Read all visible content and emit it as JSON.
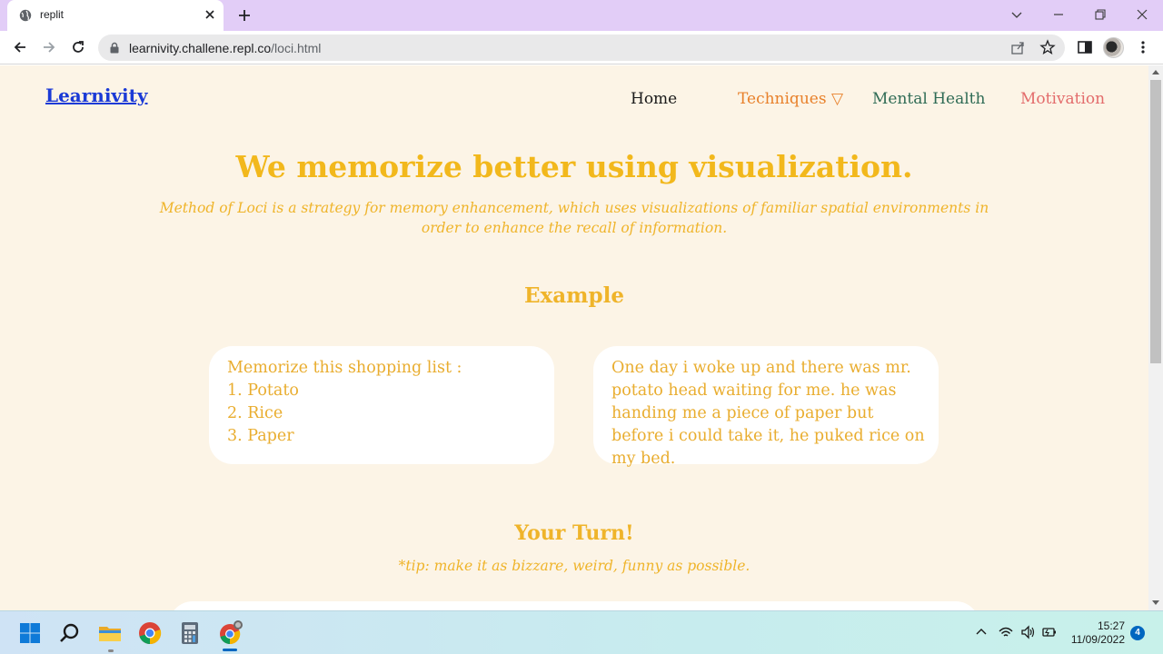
{
  "browser": {
    "tab_title": "replit",
    "url_host": "learnivity.challene.repl.co",
    "url_path": "/loci.html"
  },
  "site": {
    "brand": "Learnivity",
    "nav": {
      "home": "Home",
      "techniques": "Techniques ▽",
      "mental_health": "Mental Health",
      "motivation": "Motivation"
    },
    "headline": "We memorize better using visualization.",
    "lead": "Method of Loci is a strategy for memory enhancement, which uses visualizations of familiar spatial environments in order to enhance the recall of information.",
    "example_title": "Example",
    "example_left": {
      "heading": "Memorize this shopping list :",
      "items": [
        "1. Potato",
        "2. Rice",
        "3. Paper"
      ]
    },
    "example_right": "One day i woke up and there was mr. potato head waiting for me. he was handing me a piece of paper but before i could take it, he puked rice on my bed.",
    "your_turn_title": "Your Turn!",
    "tip": "*tip: make it as bizzare, weird, funny as possible."
  },
  "taskbar": {
    "time": "15:27",
    "date": "11/09/2022",
    "notification_count": "4"
  },
  "colors": {
    "page_bg": "#fcf4e6",
    "accent_yellow": "#f2b81c",
    "brand_blue": "#1b3ad6",
    "tab_strip": "#e2cdf7"
  }
}
